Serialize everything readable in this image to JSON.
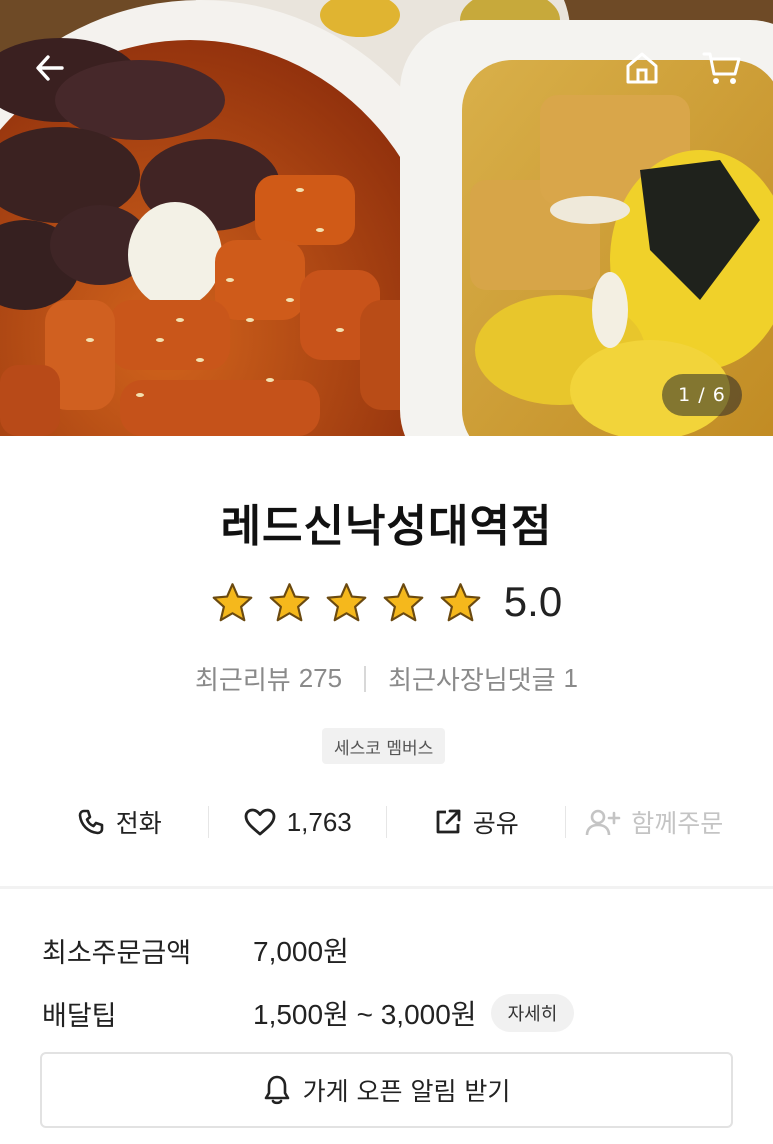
{
  "gallery": {
    "counter": "1 / 6"
  },
  "store": {
    "name": "레드신낙성대역점",
    "rating": "5.0",
    "rating_stars": 5,
    "recent_reviews_label": "최근리뷰",
    "recent_reviews_count": "275",
    "owner_comments_label": "최근사장님댓글",
    "owner_comments_count": "1",
    "badge": "세스코 멤버스"
  },
  "actions": {
    "call_label": "전화",
    "like_count": "1,763",
    "share_label": "공유",
    "group_order_label": "함께주문"
  },
  "order_info": {
    "min_order_label": "최소주문금액",
    "min_order_value": "7,000원",
    "delivery_tip_label": "배달팁",
    "delivery_tip_value": "1,500원 ~ 3,000원",
    "detail_button": "자세히"
  },
  "notify_button": "가게 오픈 알림 받기",
  "icons": [
    "back-arrow-icon",
    "home-icon",
    "cart-icon",
    "star-icon",
    "phone-icon",
    "heart-icon",
    "share-icon",
    "add-person-icon",
    "bell-icon"
  ],
  "colors": {
    "star": "#f5b81c",
    "star_stroke": "#6b4a10",
    "text_primary": "#1a1a1a",
    "text_secondary": "#8a8a8a",
    "disabled": "#c4c4c4"
  }
}
